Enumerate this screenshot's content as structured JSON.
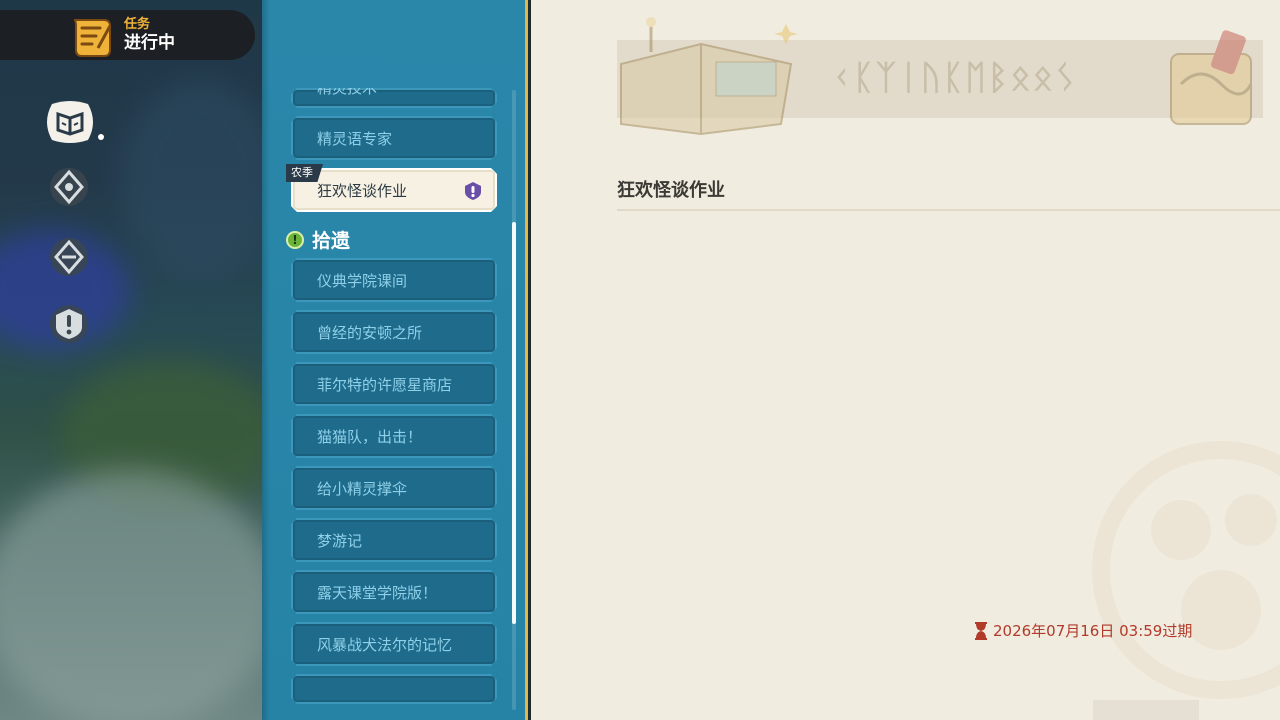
{
  "header": {
    "subtitle": "任务",
    "title": "进行中"
  },
  "sidebar_icons": [
    {
      "name": "quest-book-icon",
      "active": true
    },
    {
      "name": "compass-badge-icon"
    },
    {
      "name": "compass-badge-alt-icon"
    },
    {
      "name": "alert-badge-icon"
    }
  ],
  "quest_list": {
    "items_top": [
      {
        "label": "精灵技术",
        "partial": true
      },
      {
        "label": "精灵语专家"
      }
    ],
    "selected": {
      "tag": "农季",
      "label": "狂欢怪谈作业"
    },
    "section": {
      "title": "拾遗"
    },
    "section_items": [
      {
        "label": "仪典学院课间"
      },
      {
        "label": "曾经的安顿之所"
      },
      {
        "label": "菲尔特的许愿星商店"
      },
      {
        "label": "猫猫队，出击！"
      },
      {
        "label": "给小精灵撑伞"
      },
      {
        "label": "梦游记"
      },
      {
        "label": "露天课堂学院版！"
      },
      {
        "label": "风暴战犬法尔的记忆"
      }
    ]
  },
  "detail": {
    "title": "狂欢怪谈作业",
    "expiry": "2026年07月16日 03:59过期"
  },
  "colors": {
    "accent_gold": "#e7b446",
    "list_blue": "#2a87aa",
    "item_blue": "#1e6b8c",
    "item_text": "#8fd0e8",
    "expiry_red": "#b23a2a",
    "parchment": "#f1ece0"
  }
}
